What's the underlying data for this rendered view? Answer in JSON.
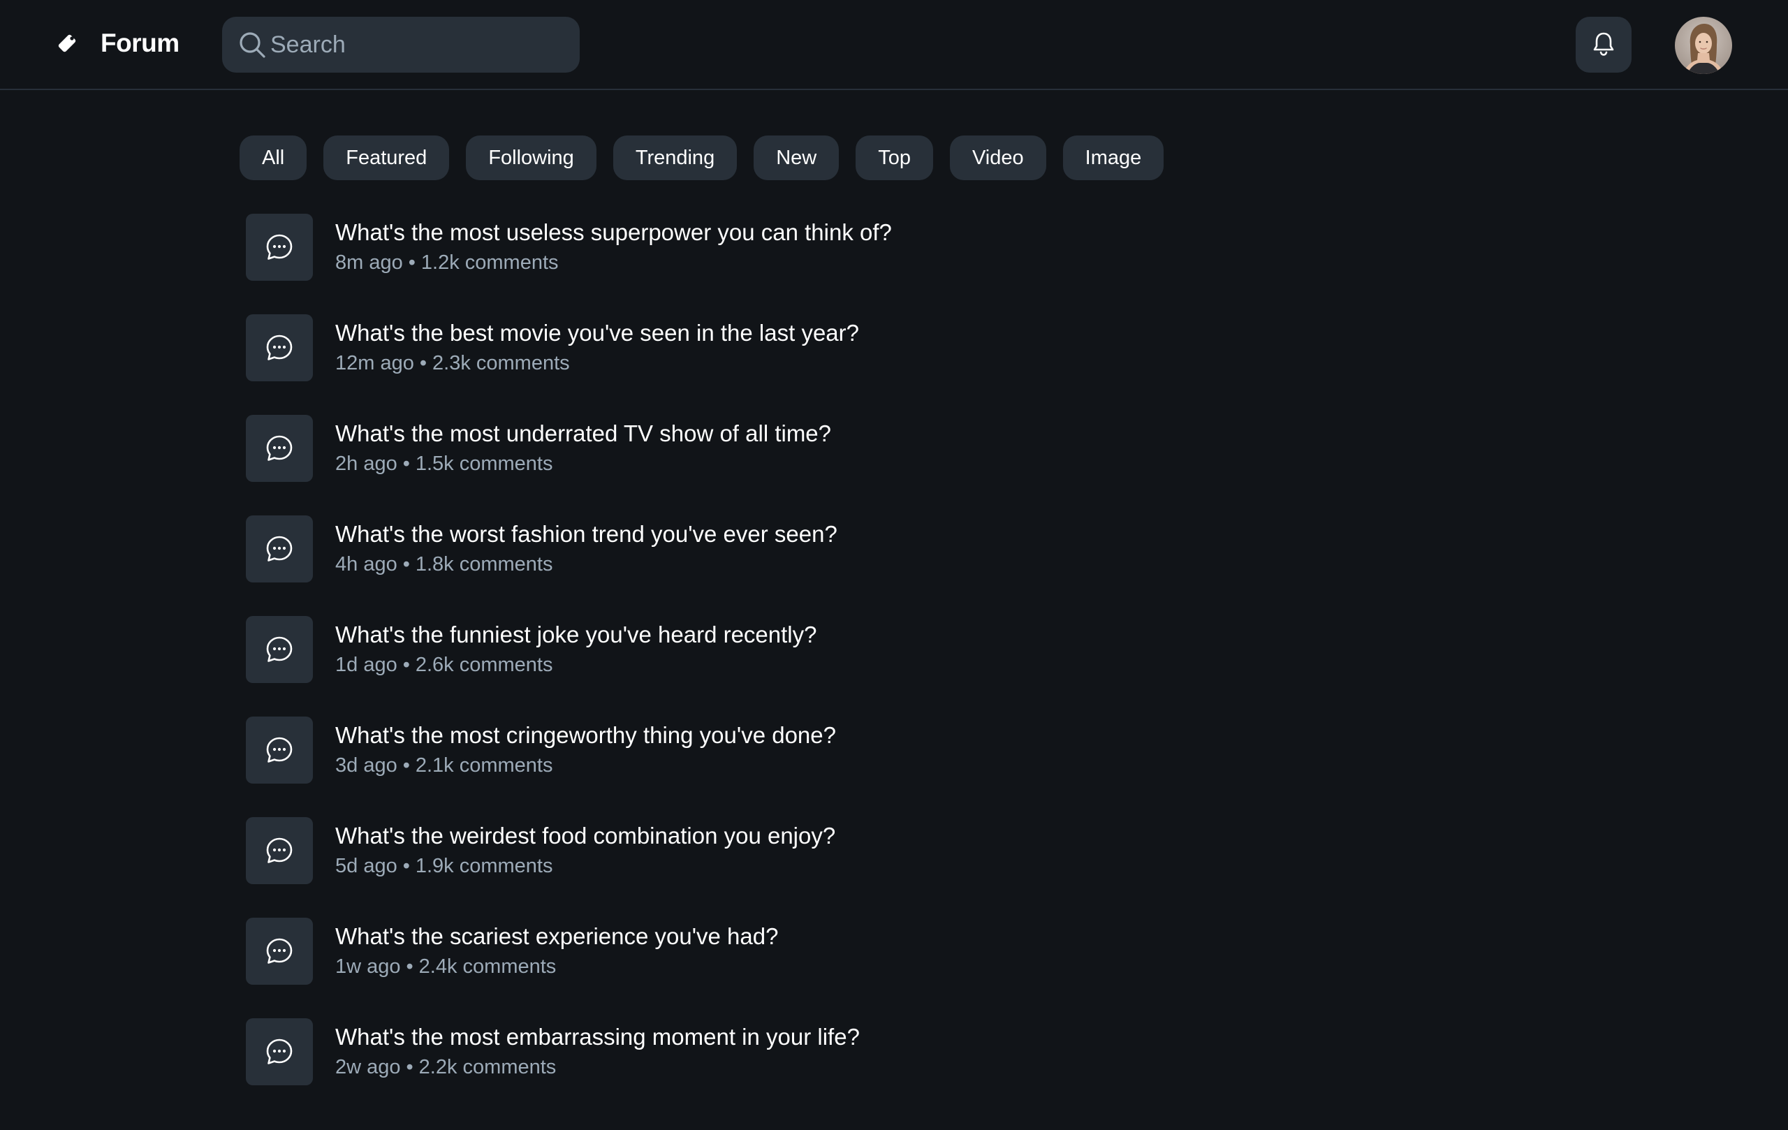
{
  "header": {
    "brand": "Forum",
    "search_placeholder": "Search",
    "notifications_icon": "bell-icon",
    "avatar_alt": "User avatar"
  },
  "filters": [
    "All",
    "Featured",
    "Following",
    "Trending",
    "New",
    "Top",
    "Video",
    "Image"
  ],
  "threads": [
    {
      "title": "What's the most useless superpower you can think of?",
      "age": "8m ago",
      "comments": "1.2k comments"
    },
    {
      "title": "What's the best movie you've seen in the last year?",
      "age": "12m ago",
      "comments": "2.3k comments"
    },
    {
      "title": "What's the most underrated TV show of all time?",
      "age": "2h ago",
      "comments": "1.5k comments"
    },
    {
      "title": "What's the worst fashion trend you've ever seen?",
      "age": "4h ago",
      "comments": "1.8k comments"
    },
    {
      "title": "What's the funniest joke you've heard recently?",
      "age": "1d ago",
      "comments": "2.6k comments"
    },
    {
      "title": "What's the most cringeworthy thing you've done?",
      "age": "3d ago",
      "comments": "2.1k comments"
    },
    {
      "title": "What's the weirdest food combination you enjoy?",
      "age": "5d ago",
      "comments": "1.9k comments"
    },
    {
      "title": "What's the scariest experience you've had?",
      "age": "1w ago",
      "comments": "2.4k comments"
    },
    {
      "title": "What's the most embarrassing moment in your life?",
      "age": "2w ago",
      "comments": "2.2k comments"
    }
  ],
  "meta_separator": "•",
  "colors": {
    "background": "#111418",
    "surface": "#283039",
    "text": "#ffffff",
    "muted_text": "#9dabb8",
    "divider": "#283039"
  }
}
